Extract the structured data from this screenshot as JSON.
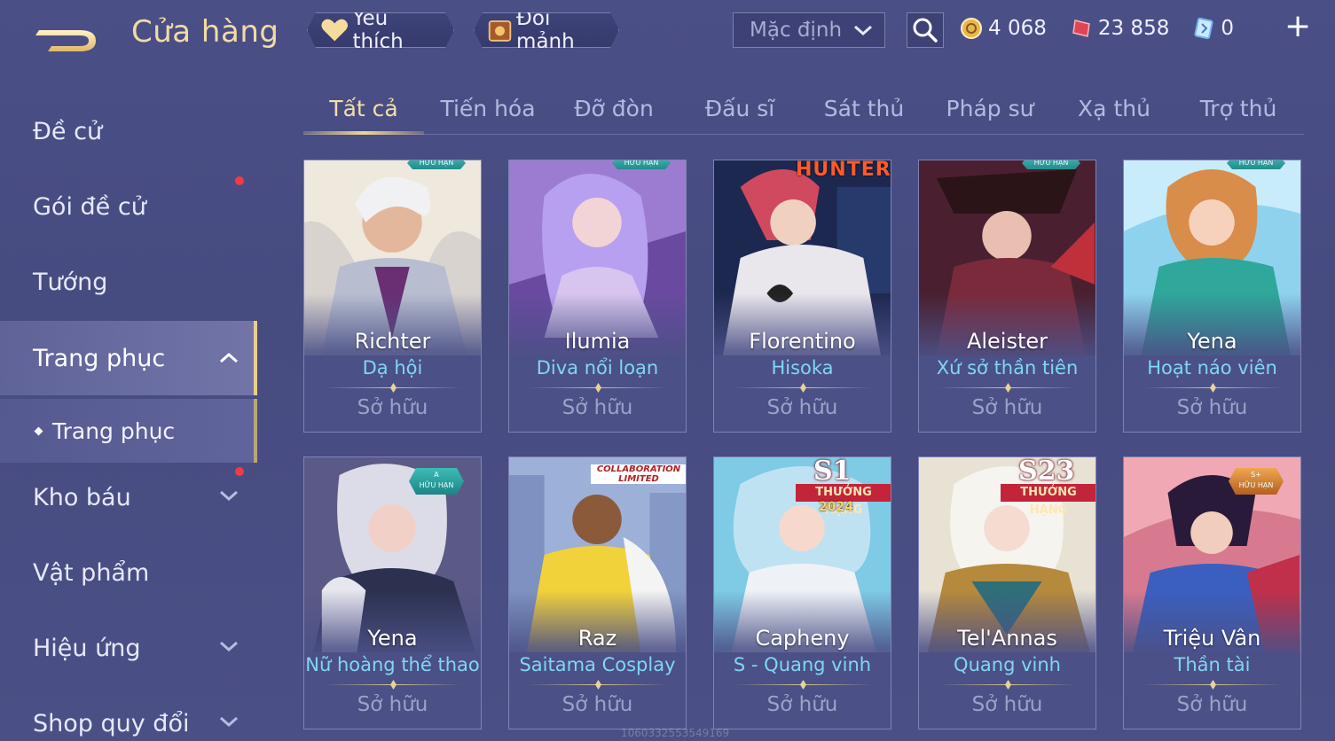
{
  "header": {
    "title": "Cửa hàng",
    "favorites_label": "Yêu thích",
    "exchange_label": "Đổi mảnh",
    "sort_value": "Mặc định",
    "currencies": [
      {
        "icon": "gold-coin-icon",
        "value": "4 068"
      },
      {
        "icon": "red-voucher-icon",
        "value": "23 858"
      },
      {
        "icon": "blue-crystal-icon",
        "value": "0"
      }
    ],
    "plus_label": "+"
  },
  "sidebar": {
    "items": [
      {
        "label": "Đề cử"
      },
      {
        "label": "Gói đề cử"
      },
      {
        "label": "Tướng"
      },
      {
        "label": "Trang phục"
      },
      {
        "label": "Kho báu"
      },
      {
        "label": "Vật phẩm"
      },
      {
        "label": "Hiệu ứng"
      },
      {
        "label": "Shop quy đổi"
      }
    ],
    "sub_item": "Trang phục"
  },
  "tabs": [
    "Tất cả",
    "Tiến hóa",
    "Đỡ đòn",
    "Đấu sĩ",
    "Sát thủ",
    "Pháp sư",
    "Xạ thủ",
    "Trợ thủ"
  ],
  "cards": [
    {
      "hero": "Richter",
      "skin": "Dạ hội",
      "status": "Sở hữu",
      "badge": "HỮU HẠN"
    },
    {
      "hero": "Ilumia",
      "skin": "Diva nổi loạn",
      "status": "Sở hữu",
      "badge": "HỮU HẠN"
    },
    {
      "hero": "Florentino",
      "skin": "Hisoka",
      "status": "Sở hữu",
      "badge": "HUNTER"
    },
    {
      "hero": "Aleister",
      "skin": "Xứ sở thần tiên",
      "status": "Sở hữu",
      "badge": "HỮU HẠN"
    },
    {
      "hero": "Yena",
      "skin": "Hoạt náo viên",
      "status": "Sở hữu",
      "badge": "HỮU HẠN"
    },
    {
      "hero": "Yena",
      "skin": "Nữ hoàng thể thao",
      "status": "Sở hữu",
      "badge_top": "A",
      "badge": "HỮU HẠN"
    },
    {
      "hero": "Raz",
      "skin": "Saitama Cosplay",
      "status": "Sở hữu",
      "badge": "COLLABORATION LIMITED"
    },
    {
      "hero": "Capheny",
      "skin": "S - Quang vinh",
      "status": "Sở hữu",
      "badge_top": "S1",
      "badge": "THƯỞNG HẠNG",
      "badge_year": "2024"
    },
    {
      "hero": "Tel'Annas",
      "skin": "Quang vinh",
      "status": "Sở hữu",
      "badge_top": "S23",
      "badge": "THƯỞNG HẠNG"
    },
    {
      "hero": "Triệu Vân",
      "skin": "Thần tài",
      "status": "Sở hữu",
      "badge_top": "S+",
      "badge": "HỮU HẠN"
    }
  ],
  "watermark": "1060332553549169",
  "colors": {
    "background": "#484d83",
    "accent_gold": "#f1dca2",
    "skin_name": "#7fd6f6",
    "notification_dot": "#f33a48"
  }
}
